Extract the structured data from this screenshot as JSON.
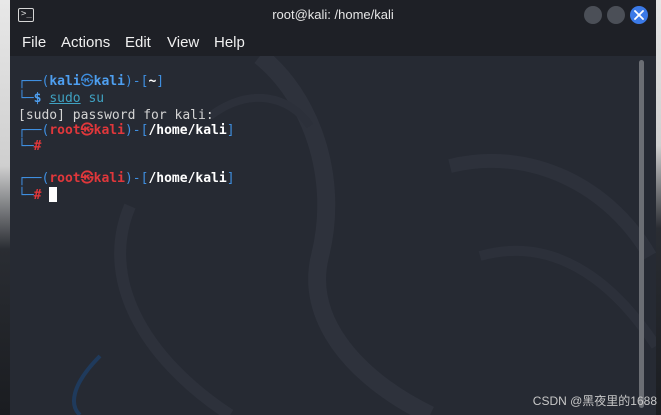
{
  "window": {
    "title": "root@kali: /home/kali",
    "icon": "terminal-icon",
    "accent": "#3b7ae8"
  },
  "menu": {
    "items": [
      "File",
      "Actions",
      "Edit",
      "View",
      "Help"
    ]
  },
  "terminal": {
    "prompt1": {
      "user": "kali",
      "host": "kali",
      "dir": "~",
      "symbol": "$",
      "command": "sudo",
      "args": " su"
    },
    "output1": "[sudo] password for kali:",
    "prompt2": {
      "user": "root",
      "host": "kali",
      "dir": "/home/kali",
      "symbol": "#"
    },
    "prompt3": {
      "user": "root",
      "host": "kali",
      "dir": "/home/kali",
      "symbol": "#"
    },
    "colors": {
      "user_prompt": "#3f8fe0",
      "root_prompt": "#e0373b",
      "command": "#3fa2c2"
    }
  },
  "watermark_credit": "CSDN @黑夜里的1688"
}
